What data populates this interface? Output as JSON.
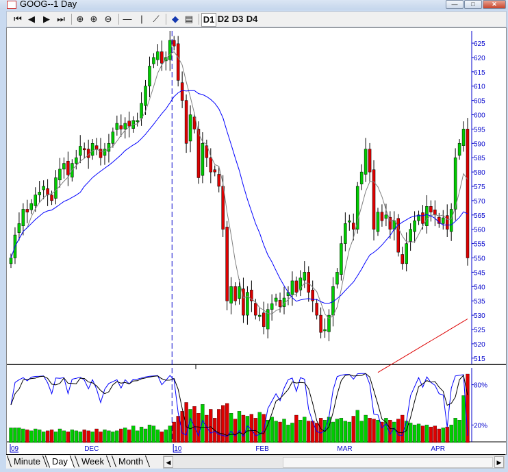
{
  "window": {
    "title": "GOOG--1 Day",
    "minimize": "—",
    "maximize": "□",
    "close": "✕"
  },
  "toolbar": {
    "nav": [
      "⏮",
      "◀",
      "▶",
      "⏭"
    ],
    "zoom": [
      "⊕",
      "⊕",
      "⊖"
    ],
    "draw": [
      "—",
      "|",
      "⟋"
    ],
    "apps": [
      "book-icon",
      "properties-icon"
    ],
    "chart_slots": [
      "D1",
      "D2",
      "D3",
      "D4"
    ]
  },
  "tabs": [
    "Minute",
    "Day",
    "Week",
    "Month"
  ],
  "active_tab": "Day",
  "colors": {
    "up": "#00cc00",
    "down": "#dd0000",
    "axis": "#0000cc",
    "ma_short": "#808080",
    "ma_mid": "#0000ff",
    "ma_long": "#dd0000"
  },
  "chart_data": {
    "type": "candlestick",
    "symbol": "GOOG",
    "interval": "1 Day",
    "price_axis": {
      "min": 513,
      "max": 627,
      "ticks": [
        515,
        520,
        525,
        530,
        535,
        540,
        545,
        550,
        555,
        560,
        565,
        570,
        575,
        580,
        585,
        590,
        595,
        600,
        605,
        610,
        615,
        620,
        625
      ]
    },
    "indicator_axis": {
      "ticks": [
        "80%",
        "20%"
      ]
    },
    "date_labels": [
      {
        "label": "09",
        "index": 0,
        "boxed": true
      },
      {
        "label": "DEC",
        "index": 18,
        "boxed": false
      },
      {
        "label": "10",
        "index": 40,
        "boxed": true
      },
      {
        "label": "FEB",
        "index": 60,
        "boxed": false
      },
      {
        "label": "MAR",
        "index": 80,
        "boxed": false
      },
      {
        "label": "APR",
        "index": 103,
        "boxed": false
      }
    ],
    "year_divider_index": 39,
    "closes": [
      550,
      558,
      562,
      567,
      566,
      569,
      572,
      573,
      575,
      572,
      570,
      578,
      581,
      583,
      579,
      583,
      585,
      589,
      588,
      585,
      590,
      588,
      585,
      588,
      590,
      594,
      597,
      595,
      597,
      596,
      598,
      598,
      604,
      610,
      617,
      620,
      622,
      618,
      620,
      626,
      624,
      612,
      605,
      590,
      600,
      595,
      578,
      590,
      585,
      580,
      580,
      575,
      560,
      535,
      540,
      535,
      540,
      530,
      538,
      535,
      530,
      530,
      526,
      532,
      534,
      536,
      533,
      536,
      538,
      542,
      538,
      543,
      545,
      538,
      535,
      530,
      524,
      525,
      530,
      540,
      545,
      555,
      562,
      563,
      560,
      575,
      580,
      588,
      580,
      560,
      566,
      563,
      565,
      560,
      563,
      552,
      548,
      555,
      560,
      563,
      565,
      562,
      568,
      566,
      565,
      562,
      564,
      560,
      567,
      585,
      590,
      595,
      550
    ],
    "volumes": [
      3,
      3,
      3,
      2.8,
      2.6,
      2.4,
      2.8,
      2.6,
      2.2,
      2.4,
      2.6,
      2.2,
      2.8,
      2.4,
      2.2,
      2.6,
      2.4,
      2.2,
      2.6,
      2.4,
      2.2,
      2.8,
      2.2,
      2.6,
      2.4,
      2.2,
      2.4,
      2.8,
      3,
      2.6,
      3.4,
      2.4,
      3.2,
      2.8,
      3.6,
      3.4,
      2.6,
      2.2,
      2.6,
      3.4,
      4.2,
      5.4,
      6.4,
      8.2,
      6.8,
      7.4,
      6,
      7.8,
      5.6,
      6.8,
      5,
      6.8,
      7.6,
      8,
      6,
      4.8,
      6.4,
      5.6,
      5.4,
      5.8,
      5,
      6.2,
      5.8,
      4.6,
      5.2,
      4.4,
      4.2,
      4.8,
      3.6,
      4,
      5.6,
      4.6,
      5.2,
      4.4,
      4.4,
      4,
      5,
      4.6,
      5.2,
      4.2,
      4.8,
      5,
      4.4,
      4.2,
      5.4,
      6.6,
      4.4,
      5.6,
      5,
      4.8,
      4.6,
      4.2,
      5,
      4.6,
      4.2,
      4.8,
      5.6,
      4.4,
      4,
      3.6,
      3.8,
      3.4,
      3.6,
      3.2,
      3.4,
      2.8,
      3,
      3.2,
      3.6,
      5,
      4.6,
      9.6,
      14
    ]
  }
}
